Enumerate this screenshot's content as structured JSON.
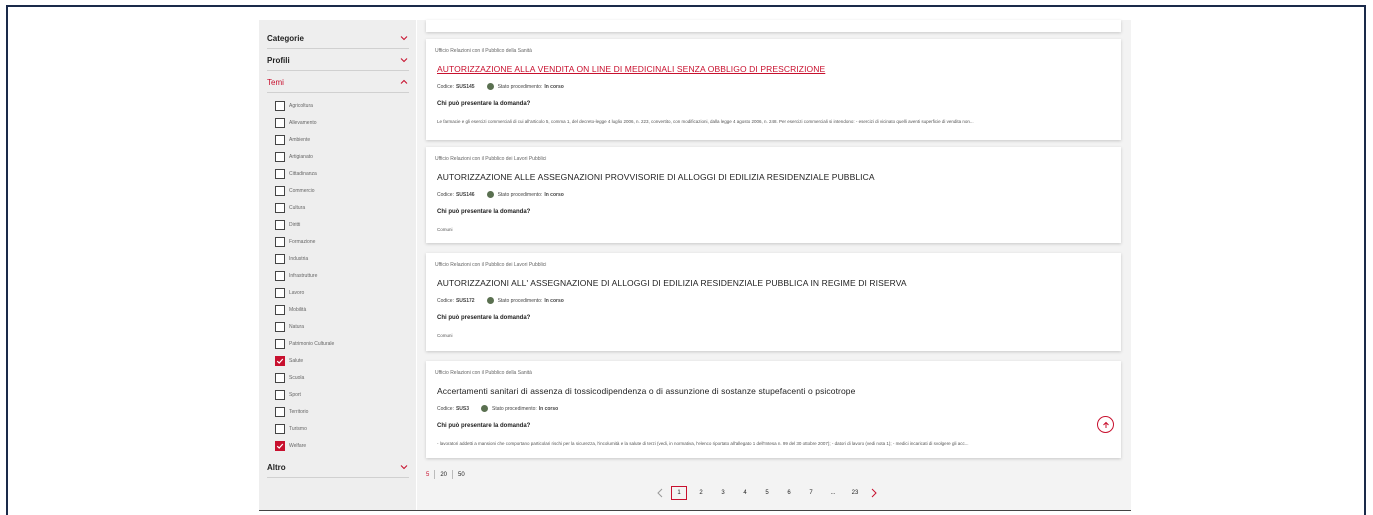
{
  "sidebar": {
    "sections": [
      {
        "label": "Categorie",
        "open": false
      },
      {
        "label": "Profili",
        "open": false
      },
      {
        "label": "Temi",
        "open": true
      }
    ],
    "themes": [
      {
        "label": "Agricoltura",
        "checked": false
      },
      {
        "label": "Allevamento",
        "checked": false
      },
      {
        "label": "Ambiente",
        "checked": false
      },
      {
        "label": "Artigianato",
        "checked": false
      },
      {
        "label": "Cittadinanza",
        "checked": false
      },
      {
        "label": "Commercio",
        "checked": false
      },
      {
        "label": "Cultura",
        "checked": false
      },
      {
        "label": "Diritti",
        "checked": false
      },
      {
        "label": "Formazione",
        "checked": false
      },
      {
        "label": "Industria",
        "checked": false
      },
      {
        "label": "Infrastrutture",
        "checked": false
      },
      {
        "label": "Lavoro",
        "checked": false
      },
      {
        "label": "Mobilità",
        "checked": false
      },
      {
        "label": "Natura",
        "checked": false
      },
      {
        "label": "Patrimonio Culturale",
        "checked": false
      },
      {
        "label": "Salute",
        "checked": true
      },
      {
        "label": "Scuola",
        "checked": false
      },
      {
        "label": "Sport",
        "checked": false
      },
      {
        "label": "Territorio",
        "checked": false
      },
      {
        "label": "Turismo",
        "checked": false
      },
      {
        "label": "Welfare",
        "checked": true
      }
    ],
    "other_section": {
      "label": "Altro",
      "open": false
    }
  },
  "cards": [
    {
      "office": "Ufficio Relazioni con il Pubblico della Sanità",
      "title": "AUTORIZZAZIONE ALLA VENDITA ON LINE DI MEDICINALI SENZA OBBLIGO DI PRESCRIZIONE",
      "code_label": "Codice:",
      "code": "SUS145",
      "status_label": "Stato procedimento:",
      "status": "In corso",
      "question": "Chi può presentare la domanda?",
      "answer": "Le farmacie e gli esercizi commerciali di cui all'articolo 5, comma 1, del decreto-legge 4 luglio 2006, n. 223, convertito, con modificazioni, dalla legge 4 agosto 2006, n. 248. Per esercizi commerciali si intendono: - esercizi di vicinato quelli aventi superficie di vendita non..."
    },
    {
      "office": "Ufficio Relazioni con il Pubblico dei Lavori Pubblici",
      "title": "AUTORIZZAZIONE ALLE ASSEGNAZIONI PROVVISORIE DI ALLOGGI DI EDILIZIA RESIDENZIALE PUBBLICA",
      "code_label": "Codice:",
      "code": "SUS146",
      "status_label": "Stato procedimento:",
      "status": "In corso",
      "question": "Chi può presentare la domanda?",
      "answer": "Comuni"
    },
    {
      "office": "Ufficio Relazioni con il Pubblico dei Lavori Pubblici",
      "title": "AUTORIZZAZIONI ALL' ASSEGNAZIONE DI ALLOGGI DI EDILIZIA RESIDENZIALE PUBBLICA IN REGIME DI RISERVA",
      "code_label": "Codice:",
      "code": "SUS172",
      "status_label": "Stato procedimento:",
      "status": "In corso",
      "question": "Chi può presentare la domanda?",
      "answer": "Comuni"
    },
    {
      "office": "Ufficio Relazioni con il Pubblico della Sanità",
      "title": "Accertamenti sanitari di assenza di tossicodipendenza o di assunzione di sostanze stupefacenti o psicotrope",
      "code_label": "Codice:",
      "code": "SUS3",
      "status_label": "Stato procedimento:",
      "status": "In corso",
      "question": "Chi può presentare la domanda?",
      "answer": "- lavoratori addetti a mansioni che comportano particolari rischi per la sicurezza, l'incolumità e la salute di terzi (vedi, in normativa, l'elenco riportato all'allegato 1 dell'Intesa n. 99 del 30 ottobre 2007); - datori di lavoro (vedi nota 1); - medici incaricati di svolgere gli acc..."
    }
  ],
  "per_page": {
    "options": [
      "5",
      "20",
      "50"
    ],
    "selected": "5"
  },
  "pagination": {
    "pages": [
      "1",
      "2",
      "3",
      "4",
      "5",
      "6",
      "7",
      "...",
      "23"
    ],
    "current": "1"
  },
  "colors": {
    "accent": "#c8102e",
    "status_dot": "#5a7050"
  }
}
